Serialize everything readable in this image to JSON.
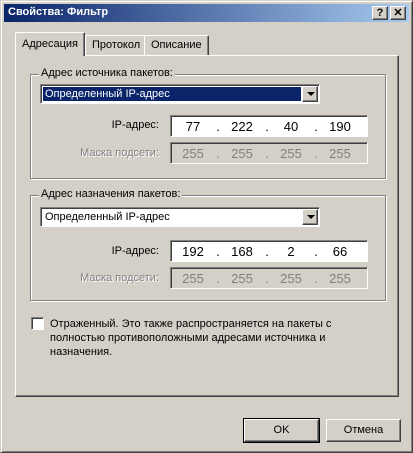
{
  "window": {
    "title": "Свойства: Фильтр",
    "help_glyph": "?",
    "close_glyph": "✕"
  },
  "tabs": [
    {
      "label": "Адресация",
      "active": true
    },
    {
      "label": "Протокол",
      "active": false
    },
    {
      "label": "Описание",
      "active": false
    }
  ],
  "source": {
    "legend": "Адрес источника пакетов:",
    "type_selected": "Определенный IP-адрес",
    "ip_label": "IP-адрес:",
    "ip": [
      "77",
      "222",
      "40",
      "190"
    ],
    "mask_label": "Маска подсети:",
    "mask": [
      "255",
      "255",
      "255",
      "255"
    ],
    "mask_enabled": false
  },
  "destination": {
    "legend": "Адрес назначения пакетов:",
    "type_selected": "Определенный IP-адрес",
    "ip_label": "IP-адрес:",
    "ip": [
      "192",
      "168",
      "2",
      "66"
    ],
    "mask_label": "Маска подсети:",
    "mask": [
      "255",
      "255",
      "255",
      "255"
    ],
    "mask_enabled": false
  },
  "mirrored": {
    "checked": false,
    "label": "Отраженный. Это также распространяется на пакеты с полностью противоположными адресами источника и назначения."
  },
  "buttons": {
    "ok": "OK",
    "cancel": "Отмена"
  },
  "ip_separator": "."
}
